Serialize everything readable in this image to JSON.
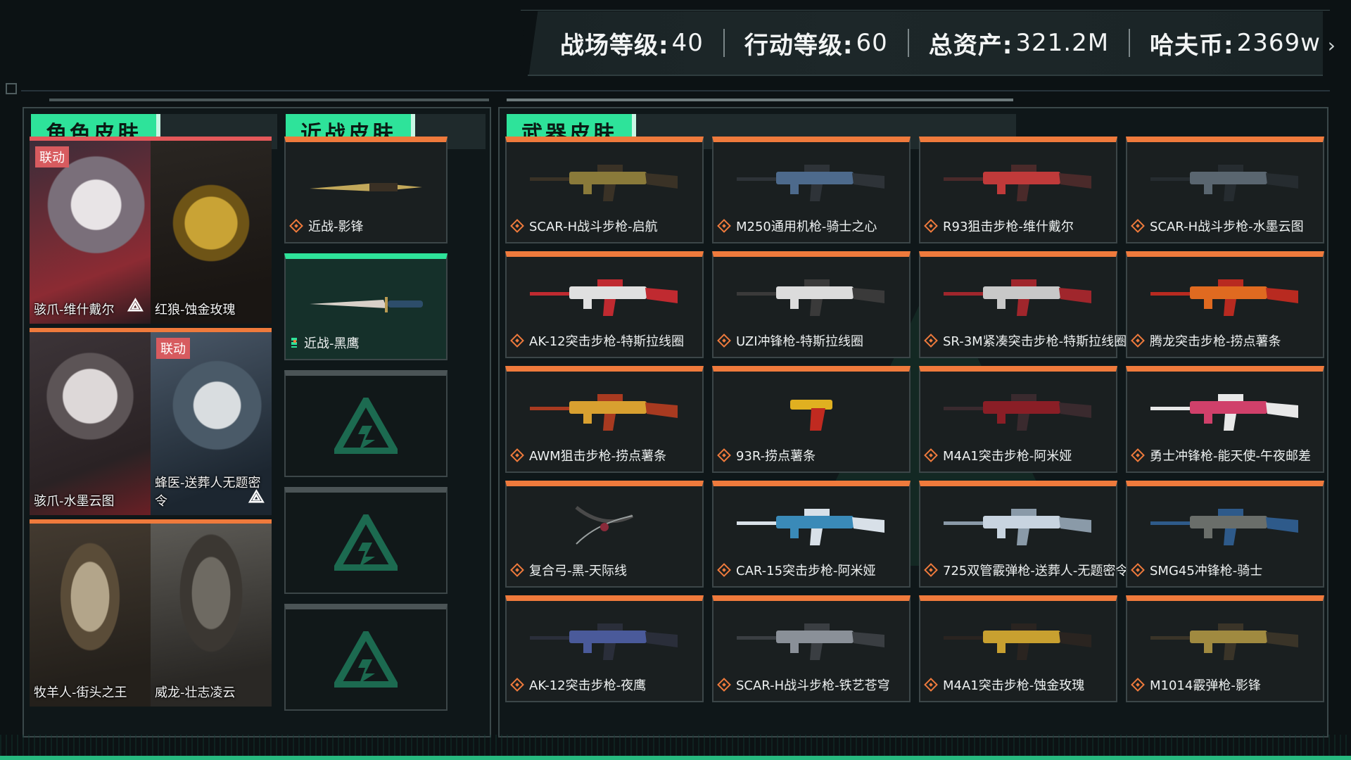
{
  "header": {
    "stats": [
      {
        "label": "战场等级:",
        "value": "40"
      },
      {
        "label": "行动等级:",
        "value": "60"
      },
      {
        "label": "总资产:",
        "value": "321.2M"
      },
      {
        "label": "哈夫币:",
        "value": "2369w"
      }
    ],
    "next_icon": "chevron-right-icon"
  },
  "sections": {
    "character": "角色皮肤",
    "melee": "近战皮肤",
    "weapon": "武器皮肤"
  },
  "characters": [
    {
      "name": "骇爪-维什戴尔",
      "badge": "联动",
      "brand": "⟁"
    },
    {
      "name": "红狼-蚀金玫瑰",
      "badge": "",
      "brand": ""
    },
    {
      "name": "骇爪-水墨云图",
      "badge": "",
      "brand": ""
    },
    {
      "name": "蜂医-送葬人无题密令",
      "badge": "联动",
      "brand": "⟁"
    },
    {
      "name": "牧羊人-街头之王",
      "badge": "",
      "brand": ""
    },
    {
      "name": "威龙-壮志凌云",
      "badge": "",
      "brand": ""
    }
  ],
  "melee": [
    {
      "name": "近战-影锋",
      "state": "owned"
    },
    {
      "name": "近战-黑鹰",
      "state": "selected"
    },
    {
      "name": "",
      "state": "empty"
    },
    {
      "name": "",
      "state": "empty"
    },
    {
      "name": "",
      "state": "empty"
    }
  ],
  "weapons": [
    "SCAR-H战斗步枪-启航",
    "M250通用机枪-骑士之心",
    "R93狙击步枪-维什戴尔",
    "SCAR-H战斗步枪-水墨云图",
    "AK-12突击步枪-特斯拉线圈",
    "UZI冲锋枪-特斯拉线圈",
    "SR-3M紧凑突击步枪-特斯拉线圈",
    "腾龙突击步枪-捞点薯条",
    "AWM狙击步枪-捞点薯条",
    "93R-捞点薯条",
    "M4A1突击步枪-阿米娅",
    "勇士冲锋枪-能天使-午夜邮差",
    "复合弓-黑-天际线",
    "CAR-15突击步枪-阿米娅",
    "725双管霰弹枪-送葬人-无题密令",
    "SMG45冲锋枪-骑士",
    "AK-12突击步枪-夜鹰",
    "SCAR-H战斗步枪-铁艺苍穹",
    "M4A1突击步枪-蚀金玫瑰",
    "M1014霰弹枪-影锋"
  ],
  "colors": {
    "accent_green": "#2ee39a",
    "accent_orange": "#ef7a3c",
    "badge_red": "#d75b5f"
  }
}
